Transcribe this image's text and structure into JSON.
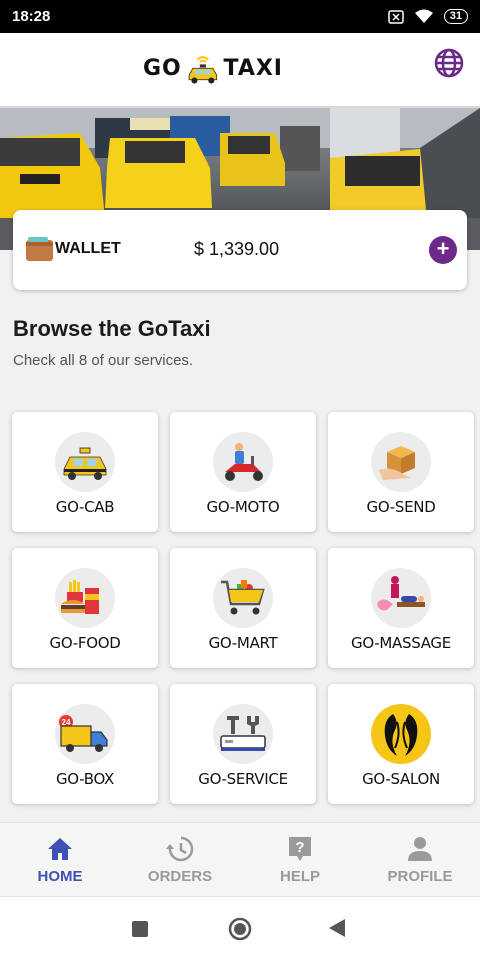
{
  "status_bar": {
    "time": "18:28",
    "battery": "31"
  },
  "header": {
    "logo_left": "GO",
    "logo_right": "TAXI",
    "globe_icon": "globe-icon"
  },
  "wallet": {
    "label": "WALLET",
    "amount": "$ 1,339.00",
    "add_symbol": "+"
  },
  "browse": {
    "title": "Browse the GoTaxi",
    "subtitle": "Check all 8 of our services."
  },
  "services": [
    {
      "label": "GO-CAB",
      "icon": "taxi-icon"
    },
    {
      "label": "GO-MOTO",
      "icon": "scooter-icon"
    },
    {
      "label": "GO-SEND",
      "icon": "package-icon"
    },
    {
      "label": "GO-FOOD",
      "icon": "fastfood-icon"
    },
    {
      "label": "GO-MART",
      "icon": "shopping-cart-icon"
    },
    {
      "label": "GO-MASSAGE",
      "icon": "massage-icon"
    },
    {
      "label": "GO-BOX",
      "icon": "delivery-truck-icon"
    },
    {
      "label": "GO-SERVICE",
      "icon": "tools-icon"
    },
    {
      "label": "GO-SALON",
      "icon": "salon-icon"
    }
  ],
  "bottom_nav": [
    {
      "label": "HOME",
      "icon": "home-icon",
      "active": true
    },
    {
      "label": "ORDERS",
      "icon": "history-icon",
      "active": false
    },
    {
      "label": "HELP",
      "icon": "help-icon",
      "active": false
    },
    {
      "label": "PROFILE",
      "icon": "person-icon",
      "active": false
    }
  ],
  "colors": {
    "accent": "#3f51b5",
    "wallet_add": "#6b2a8a",
    "inactive_nav": "#9a9a9a",
    "taxi_yellow": "#f5c518"
  }
}
